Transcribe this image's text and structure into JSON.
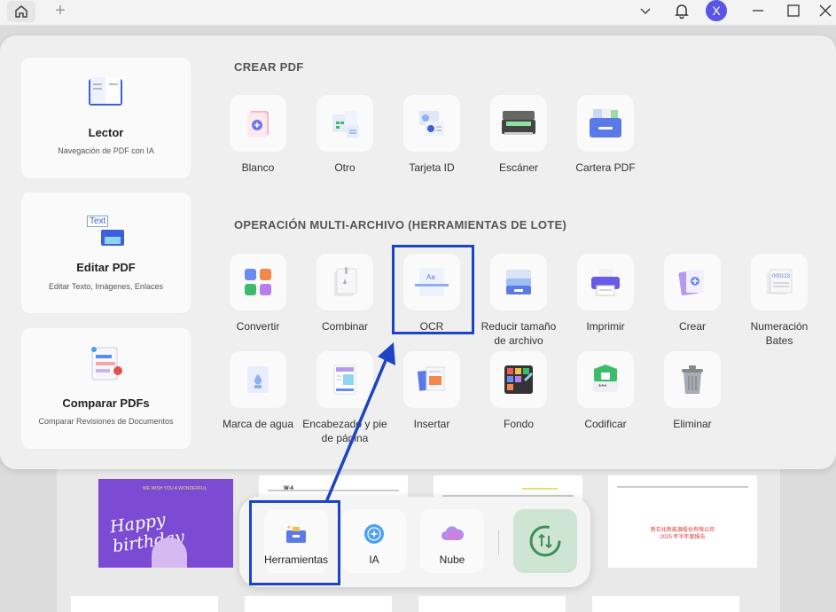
{
  "titlebar": {
    "avatar_initial": "X"
  },
  "sidebar": {
    "cards": [
      {
        "title": "Lector",
        "subtitle": "Navegación de PDF con IA"
      },
      {
        "title": "Editar PDF",
        "subtitle": "Editar Texto, Imágenes, Enlaces",
        "icon_text": "Text"
      },
      {
        "title": "Comparar PDFs",
        "subtitle": "Comparar Revisiones de Documentos"
      }
    ]
  },
  "crear": {
    "title": "CREAR PDF",
    "tools": [
      "Blanco",
      "Otro",
      "Tarjeta ID",
      "Escáner",
      "Cartera PDF"
    ]
  },
  "batch": {
    "title": "OPERACIÓN MULTI-ARCHIVO (HERRAMIENTAS DE LOTE)",
    "row1": [
      {
        "label": "Convertir"
      },
      {
        "label": "Combinar"
      },
      {
        "label": "OCR",
        "icon_text": "Aa"
      },
      {
        "label_1": "Reducir tamaño",
        "label_2": "de archivo"
      },
      {
        "label": "Imprimir"
      },
      {
        "label": "Crear"
      },
      {
        "label_1": "Numeración",
        "label_2": "Bates",
        "icon_text": "000123"
      }
    ],
    "row2": [
      {
        "label": "Marca de agua"
      },
      {
        "label_1": "Encabezado y pie",
        "label_2": "de página"
      },
      {
        "label": "Insertar"
      },
      {
        "label": "Fondo"
      },
      {
        "label": "Codificar",
        "icon_text": "***"
      },
      {
        "label": "Eliminar"
      }
    ]
  },
  "dock": {
    "items": [
      "Herramientas",
      "IA",
      "Nube"
    ]
  },
  "background_docs": {
    "birthday_title": "Happy birthday",
    "birthday_small": "WE WISH YOU A WONDERFUL",
    "doc2_header": "W-4",
    "doc4_text_1": "新石化新能源股份有限公司",
    "doc4_text_2": "2025 年半年度报告"
  },
  "colors": {
    "accent": "#1c44c5",
    "avatar": "#5a55e8",
    "birthday_bg": "#7c4bd4",
    "sync_bg": "#cfe5d3"
  }
}
